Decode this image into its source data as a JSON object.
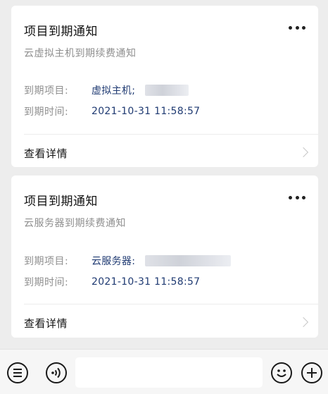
{
  "cards": [
    {
      "title": "项目到期通知",
      "subtitle": "云虚拟主机到期续费通知",
      "rows": [
        {
          "label": "到期项目:",
          "value": "虚拟主机;"
        },
        {
          "label": "到期时间:",
          "value": "2021-10-31 11:58:57"
        }
      ],
      "details_label": "查看详情"
    },
    {
      "title": "项目到期通知",
      "subtitle": "云服务器到期续费通知",
      "rows": [
        {
          "label": "到期项目:",
          "value": "云服务器:"
        },
        {
          "label": "到期时间:",
          "value": "2021-10-31 11:58:57"
        }
      ],
      "details_label": "查看详情"
    }
  ],
  "input_bar": {
    "icons": [
      "menu-icon",
      "voice-icon",
      "emoji-icon",
      "plus-icon"
    ],
    "input_value": ""
  }
}
